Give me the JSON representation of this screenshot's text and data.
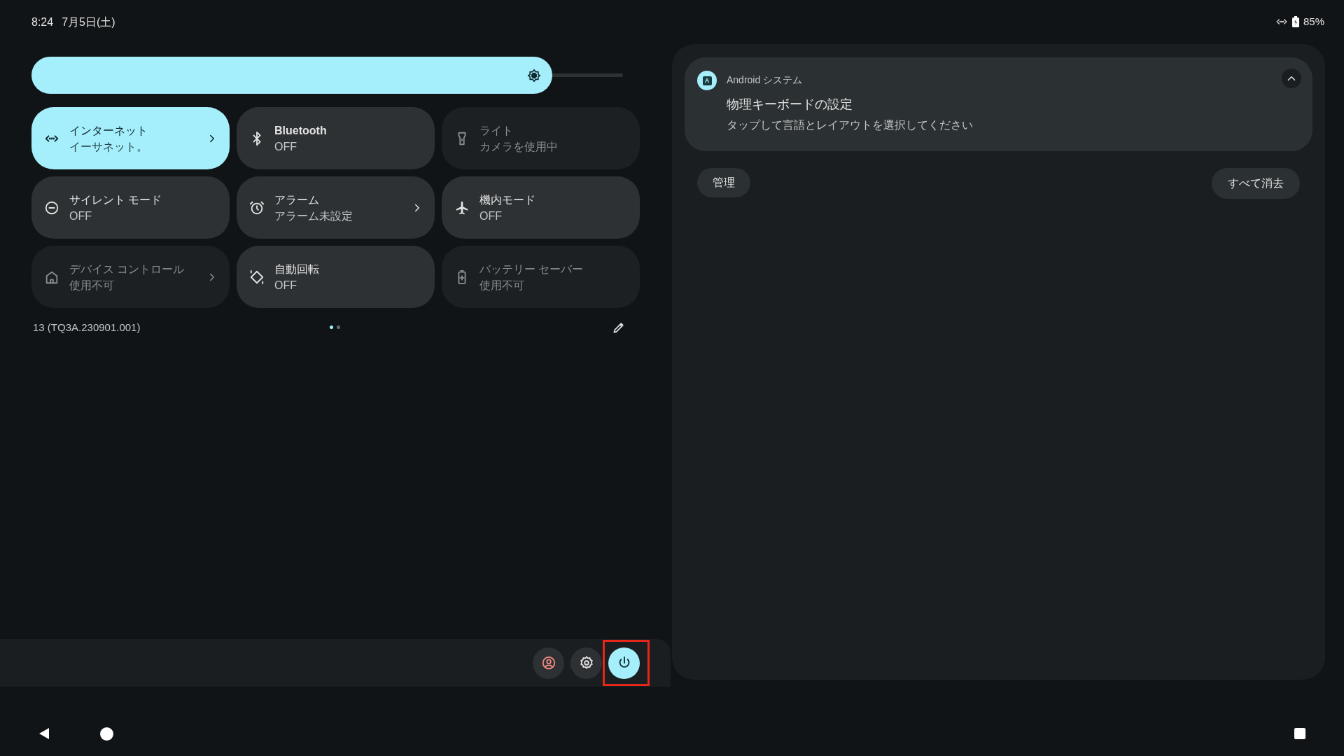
{
  "status_bar": {
    "time": "8:24",
    "date": "7月5日(土)",
    "battery": "85%"
  },
  "brightness": {
    "level": 0.88
  },
  "tiles": [
    {
      "kind": "ethernet",
      "title": "インターネット",
      "subtitle": "イーサネット。",
      "on": true,
      "disabled": false,
      "chevron": true
    },
    {
      "kind": "bluetooth",
      "title": "Bluetooth",
      "subtitle": "OFF",
      "on": false,
      "disabled": false,
      "chevron": false
    },
    {
      "kind": "flashlight",
      "title": "ライト",
      "subtitle": "カメラを使用中",
      "on": false,
      "disabled": true,
      "chevron": false
    },
    {
      "kind": "dnd",
      "title": "サイレント モード",
      "subtitle": "OFF",
      "on": false,
      "disabled": false,
      "chevron": false
    },
    {
      "kind": "alarm",
      "title": "アラーム",
      "subtitle": "アラーム未設定",
      "on": false,
      "disabled": false,
      "chevron": true
    },
    {
      "kind": "airplane",
      "title": "機内モード",
      "subtitle": "OFF",
      "on": false,
      "disabled": false,
      "chevron": false
    },
    {
      "kind": "home",
      "title": "デバイス コントロール",
      "subtitle": "使用不可",
      "on": false,
      "disabled": true,
      "chevron": true
    },
    {
      "kind": "rotate",
      "title": "自動回転",
      "subtitle": "OFF",
      "on": false,
      "disabled": false,
      "chevron": false
    },
    {
      "kind": "battery",
      "title": "バッテリー セーバー",
      "subtitle": "使用不可",
      "on": false,
      "disabled": true,
      "chevron": false
    }
  ],
  "build": "13 (TQ3A.230901.001)",
  "pages": [
    {
      "selected": true
    },
    {
      "selected": false
    }
  ],
  "notification": {
    "app": "Android システム",
    "app_letter": "A",
    "title": "物理キーボードの設定",
    "text": "タップして言語とレイアウトを選択してください",
    "expanded": true
  },
  "notification_actions": {
    "manage": "管理",
    "clear_all": "すべて消去"
  },
  "footer_buttons": [
    {
      "kind": "user",
      "highlighted": false
    },
    {
      "kind": "settings",
      "highlighted": false
    },
    {
      "kind": "power",
      "highlighted": true
    }
  ]
}
